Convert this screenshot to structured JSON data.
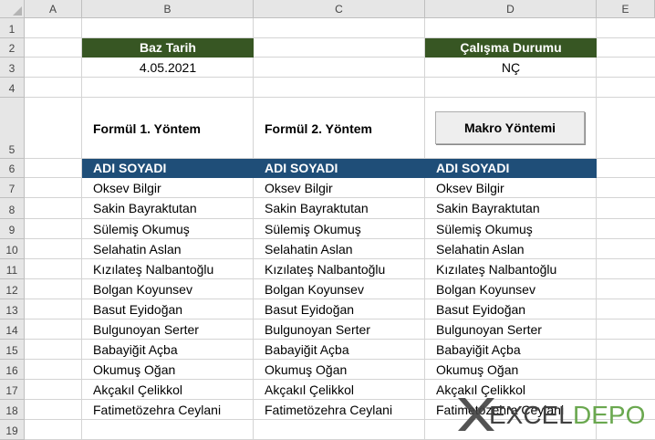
{
  "columns": [
    "A",
    "B",
    "C",
    "D",
    "E"
  ],
  "rows": [
    "1",
    "2",
    "3",
    "4",
    "5",
    "6",
    "7",
    "8",
    "9",
    "10",
    "11",
    "12",
    "13",
    "14",
    "15",
    "16",
    "17",
    "18",
    "19"
  ],
  "baz_tarih": {
    "label": "Baz Tarih",
    "value": "4.05.2021"
  },
  "calisma_durumu": {
    "label": "Çalışma Durumu",
    "value": "NÇ"
  },
  "headings": {
    "col_b": "Formül 1. Yöntem",
    "col_c": "Formül 2. Yöntem",
    "button": "Makro Yöntemi"
  },
  "table_header": "ADI SOYADI",
  "names": [
    "Oksev Bilgir",
    "Sakin Bayraktutan",
    "Sülemiş Okumuş",
    "Selahatin Aslan",
    "Kızılateş Nalbantoğlu",
    "Bolgan Koyunsev",
    "Basut Eyidoğan",
    "Bulgunoyan Serter",
    "Babayiğit Açba",
    "Okumuş Oğan",
    "Akçakıl Çelikkol",
    "Fatimetözehra Ceylani"
  ],
  "logo": {
    "part1": "EXCEL",
    "part2": "DEPO"
  },
  "colors": {
    "green_header": "#375623",
    "blue_header": "#1f4e78",
    "logo_green": "#6aa84f"
  }
}
